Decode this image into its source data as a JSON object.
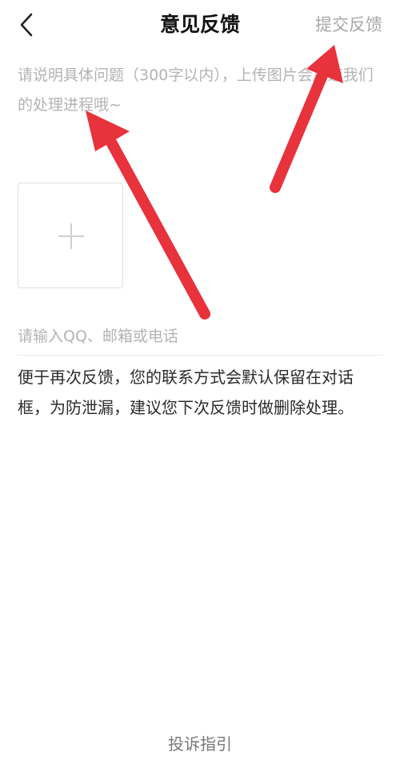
{
  "nav": {
    "title": "意见反馈",
    "submit_label": "提交反馈"
  },
  "form": {
    "description_placeholder": "请说明具体问题（300字以内），上传图片会加速我们的处理进程哦~",
    "contact_placeholder": "请输入QQ、邮箱或电话"
  },
  "notice": "便于再次反馈，您的联系方式会默认保留在对话框，为防泄漏，建议您下次反馈时做删除处理。",
  "footer": {
    "guide_label": "投诉指引"
  },
  "icons": {
    "back": "chevron-left-icon",
    "upload": "plus-icon"
  },
  "colors": {
    "annotation_arrow": "#e8323c",
    "submit_text": "#a8a8a8",
    "placeholder_text": "#b3b3b3"
  }
}
